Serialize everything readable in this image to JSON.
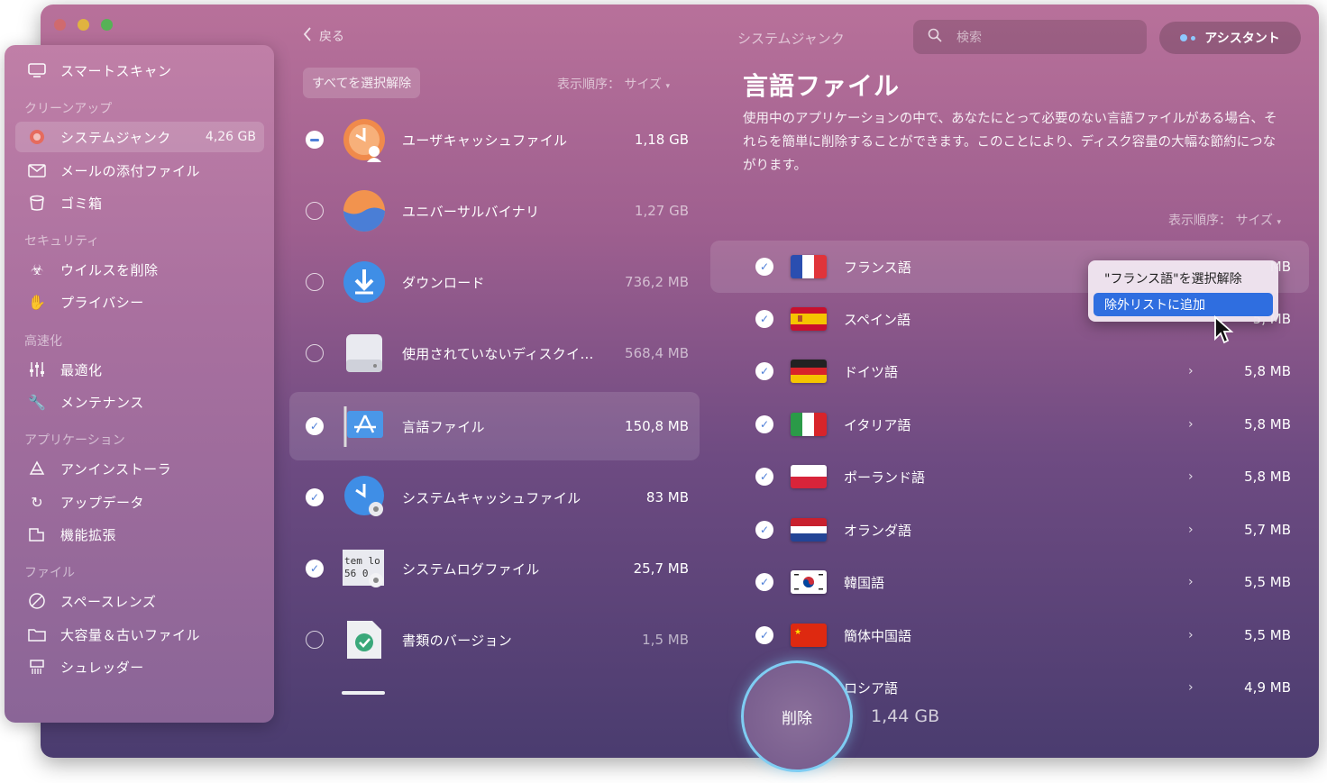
{
  "header": {
    "back_label": "戻る",
    "title": "システムジャンク",
    "search_placeholder": "検索",
    "assistant_label": "アシスタント"
  },
  "sidebar": {
    "items": [
      {
        "label": "スマートスキャン",
        "icon": "monitor-icon"
      },
      {
        "section": "クリーンアップ"
      },
      {
        "label": "システムジャンク",
        "badge": "4,26 GB",
        "icon": "junk-icon",
        "active": true
      },
      {
        "label": "メールの添付ファイル",
        "icon": "mail-icon"
      },
      {
        "label": "ゴミ箱",
        "icon": "trash-icon"
      },
      {
        "section": "セキュリティ"
      },
      {
        "label": "ウイルスを削除",
        "icon": "biohazard-icon"
      },
      {
        "label": "プライバシー",
        "icon": "hand-icon"
      },
      {
        "section": "高速化"
      },
      {
        "label": "最適化",
        "icon": "sliders-icon"
      },
      {
        "label": "メンテナンス",
        "icon": "wrench-icon"
      },
      {
        "section": "アプリケーション"
      },
      {
        "label": "アンインストーラ",
        "icon": "uninstaller-icon"
      },
      {
        "label": "アップデータ",
        "icon": "updater-icon"
      },
      {
        "label": "機能拡張",
        "icon": "extensions-icon"
      },
      {
        "section": "ファイル"
      },
      {
        "label": "スペースレンズ",
        "icon": "space-lens-icon"
      },
      {
        "label": "大容量＆古いファイル",
        "icon": "folder-icon"
      },
      {
        "label": "シュレッダー",
        "icon": "shredder-icon"
      }
    ]
  },
  "middle": {
    "deselect_all_label": "すべてを選択解除",
    "sort_label": "表示順序：",
    "sort_value": "サイズ",
    "rows": [
      {
        "name": "ユーザキャッシュファイル",
        "size": "1,18 GB",
        "state": "partial"
      },
      {
        "name": "ユニバーサルバイナリ",
        "size": "1,27 GB",
        "state": "off"
      },
      {
        "name": "ダウンロード",
        "size": "736,2 MB",
        "state": "off"
      },
      {
        "name": "使用されていないディスクイ…",
        "size": "568,4 MB",
        "state": "off"
      },
      {
        "name": "言語ファイル",
        "size": "150,8 MB",
        "state": "on",
        "active": true
      },
      {
        "name": "システムキャッシュファイル",
        "size": "83 MB",
        "state": "on"
      },
      {
        "name": "システムログファイル",
        "size": "25,7 MB",
        "state": "on"
      },
      {
        "name": "書類のバージョン",
        "size": "1,5 MB",
        "state": "off"
      }
    ],
    "log_icon_text": [
      "tem lo",
      "56 0"
    ]
  },
  "detail": {
    "heading": "言語ファイル",
    "description": "使用中のアプリケーションの中で、あなたにとって必要のない言語ファイルがある場合、それらを簡単に削除することができます。このことにより、ディスク容量の大幅な節約につながります。",
    "sort_label": "表示順序：",
    "sort_value": "サイズ",
    "languages": [
      {
        "name": "フランス語",
        "size": "MB",
        "flag": "fr",
        "active": true
      },
      {
        "name": "スペイン語",
        "size": "5,  MB",
        "flag": "es"
      },
      {
        "name": "ドイツ語",
        "size": "5,8 MB",
        "flag": "de"
      },
      {
        "name": "イタリア語",
        "size": "5,8 MB",
        "flag": "it"
      },
      {
        "name": "ポーランド語",
        "size": "5,8 MB",
        "flag": "pl"
      },
      {
        "name": "オランダ語",
        "size": "5,7 MB",
        "flag": "nl"
      },
      {
        "name": "韓国語",
        "size": "5,5 MB",
        "flag": "kr"
      },
      {
        "name": "簡体中国語",
        "size": "5,5 MB",
        "flag": "cn"
      },
      {
        "name": "ロシア語",
        "size": "4,9 MB",
        "flag": "ru"
      }
    ]
  },
  "context_menu": {
    "items": [
      "\"フランス語\"を選択解除",
      "除外リストに追加"
    ]
  },
  "footer": {
    "delete_label": "削除",
    "total": "1,44 GB"
  },
  "colors": {
    "accent": "#7fcdf3",
    "check": "#4e7fd8",
    "menu_highlight": "#2f6ee0"
  }
}
